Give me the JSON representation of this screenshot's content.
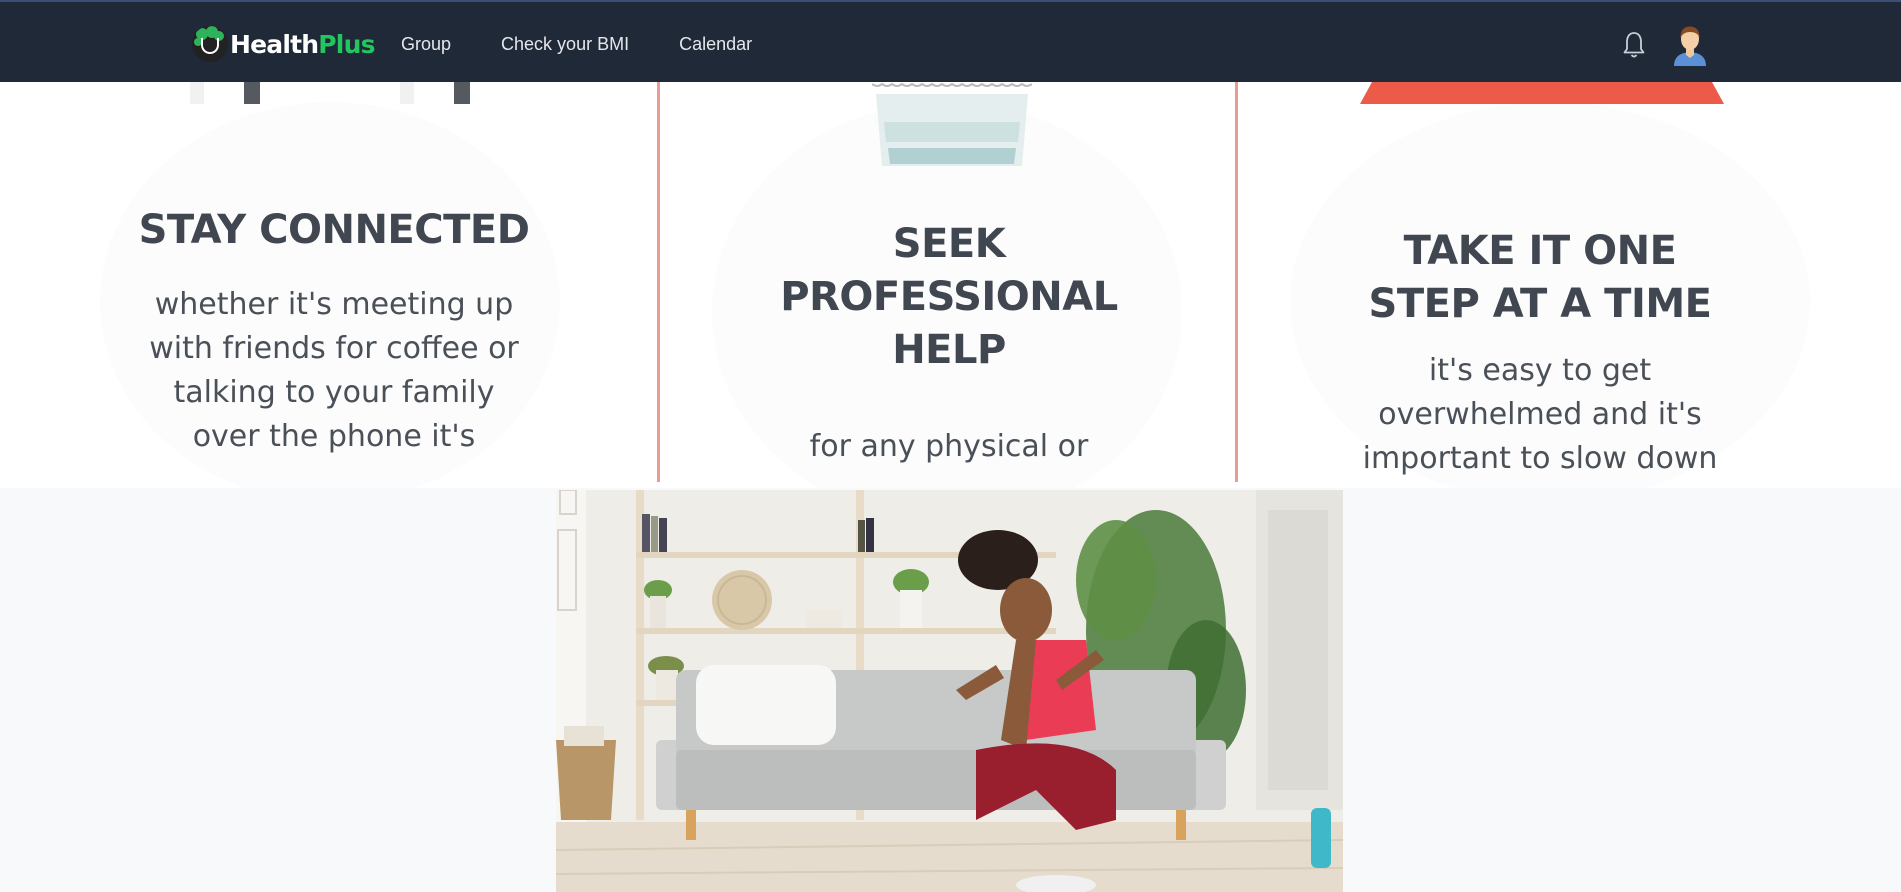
{
  "brand": {
    "name_part1": "Health",
    "name_part2": "Plus"
  },
  "nav": {
    "links": [
      {
        "label": "Group"
      },
      {
        "label": "Check your BMI"
      },
      {
        "label": "Calendar"
      }
    ],
    "icons": {
      "notifications": "bell-icon",
      "profile": "user-avatar"
    }
  },
  "infographic": {
    "panels": [
      {
        "title_lines": [
          "STAY CONNECTED"
        ],
        "body_lines": [
          "whether it's meeting up",
          "with friends for coffee or",
          "talking to your family",
          "over the phone it's"
        ]
      },
      {
        "title_lines": [
          "SEEK",
          "PROFESSIONAL",
          "HELP"
        ],
        "body_lines": [
          "for any physical or"
        ]
      },
      {
        "title_lines": [
          "TAKE IT ONE",
          "STEP AT A TIME"
        ],
        "body_lines": [
          "it's easy to get",
          "overwhelmed and it's",
          "important to slow down"
        ]
      }
    ],
    "accent_color": "#e99d92"
  },
  "hero_image": {
    "subject": "woman-exercising-in-living-room"
  },
  "colors": {
    "navbar": "#1f2937",
    "brand_accent": "#22c55e",
    "page_bg": "#f8f9fb"
  }
}
